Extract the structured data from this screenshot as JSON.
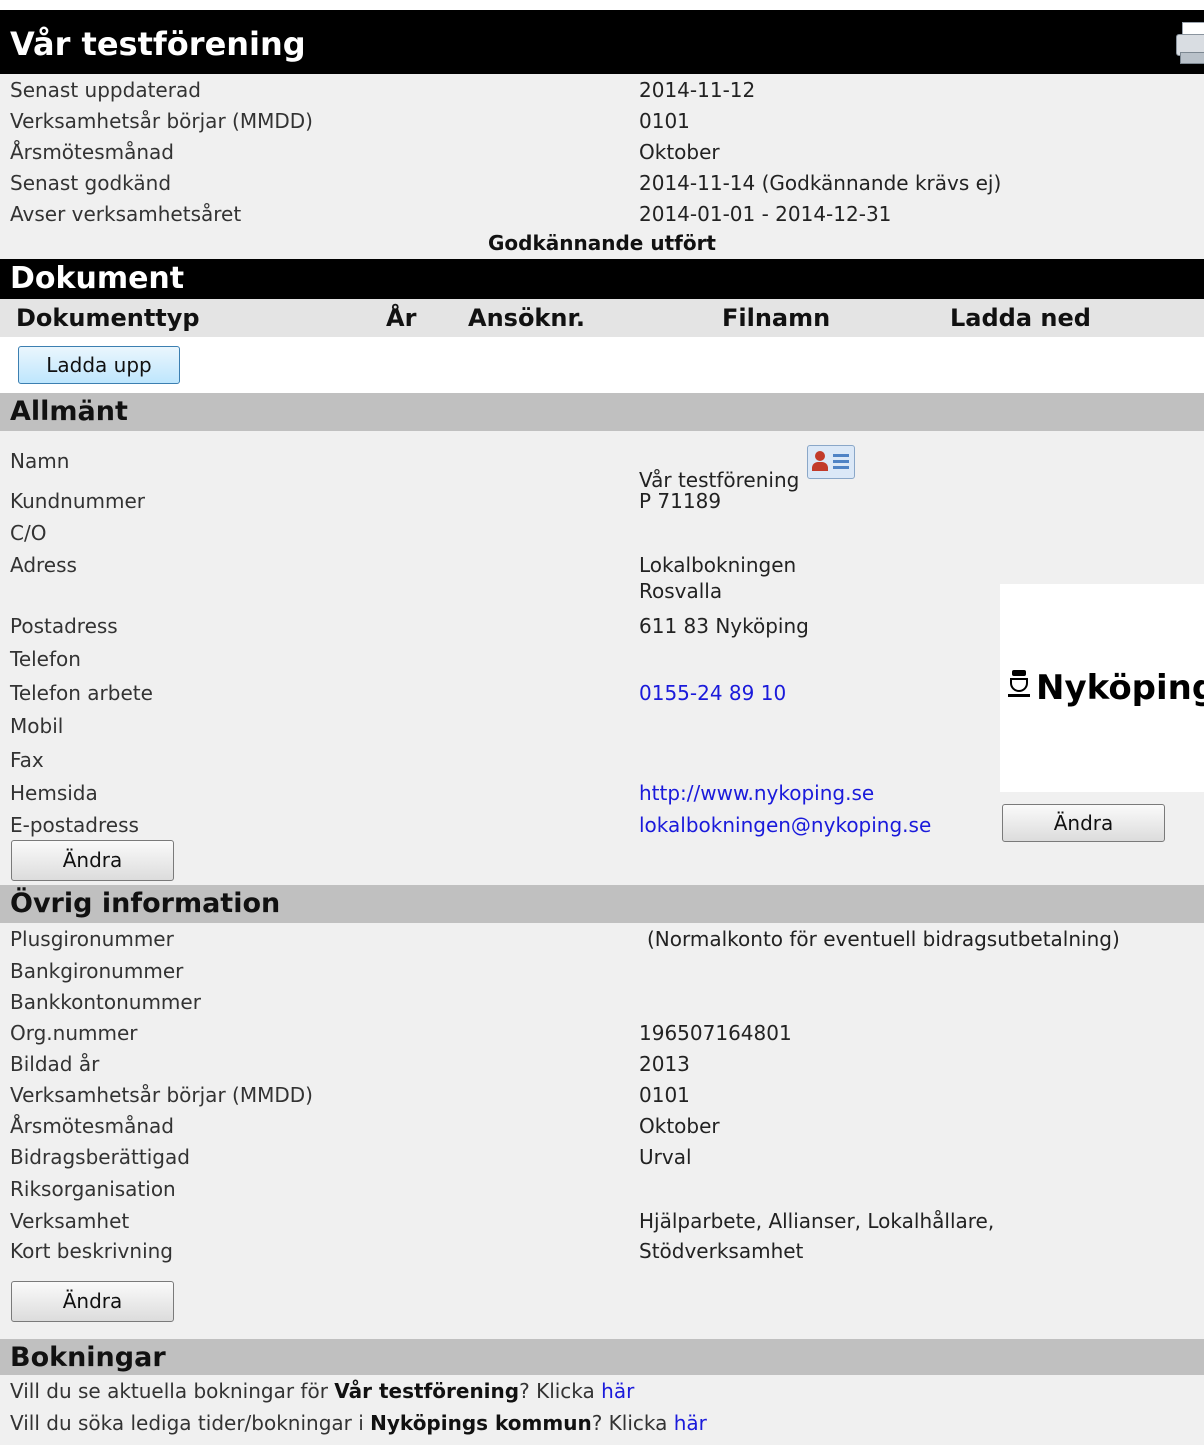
{
  "header": {
    "title": "Vår testförening",
    "print_icon": "printer-icon"
  },
  "summary": {
    "rows": [
      {
        "label": "Senast uppdaterad",
        "value": "2014-11-12"
      },
      {
        "label": "Verksamhetsår börjar (MMDD)",
        "value": "0101"
      },
      {
        "label": "Årsmötesmånad",
        "value": "Oktober"
      },
      {
        "label": "Senast godkänd",
        "value": "2014-11-14 (Godkännande krävs ej)"
      },
      {
        "label": "Avser verksamhetsåret",
        "value": "2014-01-01 - 2014-12-31"
      }
    ],
    "status": "Godkännande utfört"
  },
  "documents": {
    "title": "Dokument",
    "columns": [
      "Dokumenttyp",
      "År",
      "Ansöknr.",
      "Filnamn",
      "Ladda ned"
    ],
    "upload_label": "Ladda upp"
  },
  "general": {
    "title": "Allmänt",
    "rows": [
      {
        "label": "Namn",
        "value": "Vår testförening"
      },
      {
        "label": "Kundnummer",
        "value": "P 71189"
      },
      {
        "label": "C/O",
        "value": ""
      },
      {
        "label": "Adress",
        "value": "Lokalbokningen",
        "value2": "Rosvalla"
      },
      {
        "label": "Postadress",
        "value": "611 83  Nyköping"
      },
      {
        "label": "Telefon",
        "value": ""
      },
      {
        "label": "Telefon arbete",
        "value": "0155-24 89 10"
      },
      {
        "label": "Mobil",
        "value": ""
      },
      {
        "label": "Fax",
        "value": ""
      },
      {
        "label": "Hemsida",
        "value": "http://www.nykoping.se"
      },
      {
        "label": "E-postadress",
        "value": "lokalbokningen@nykoping.se"
      }
    ],
    "logo_text": "Nyköping",
    "logo_change_label": "Ändra",
    "change_label": "Ändra",
    "contact_icon": "contact-card-icon"
  },
  "other": {
    "title": "Övrig information",
    "rows": [
      {
        "label": "Plusgironummer",
        "value": "(Normalkonto för eventuell bidragsutbetalning)"
      },
      {
        "label": "Bankgironummer",
        "value": ""
      },
      {
        "label": "Bankkontonummer",
        "value": ""
      },
      {
        "label": "Org.nummer",
        "value": "196507164801"
      },
      {
        "label": "Bildad år",
        "value": "2013"
      },
      {
        "label": "Verksamhetsår börjar (MMDD)",
        "value": "0101"
      },
      {
        "label": "Årsmötesmånad",
        "value": "Oktober"
      },
      {
        "label": "Bidragsberättigad",
        "value": "Urval"
      },
      {
        "label": "Riksorganisation",
        "value": ""
      },
      {
        "label": "Verksamhet",
        "value": "Hjälparbete, Allianser, Lokalhållare,"
      },
      {
        "label": "Kort beskrivning",
        "value": "Stödverksamhet"
      }
    ],
    "change_label": "Ändra"
  },
  "bookings": {
    "title": "Bokningar",
    "line1": {
      "pre": "Vill du se aktuella bokningar för ",
      "bold": "Vår testförening",
      "post": "? Klicka ",
      "link": "här"
    },
    "line2": {
      "pre": "Vill du söka lediga tider/bokningar i ",
      "bold": "Nyköpings kommun",
      "post": "? Klicka ",
      "link": "här"
    }
  }
}
